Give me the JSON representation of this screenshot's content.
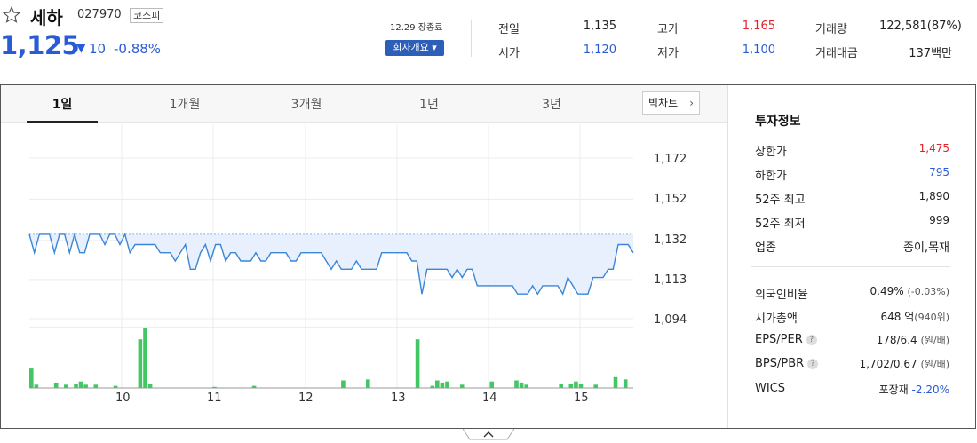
{
  "stock": {
    "name": "세하",
    "code": "027970",
    "market": "코스피",
    "price": "1,125",
    "change_arrow": "▼",
    "change": "10",
    "change_rate": "-0.88%"
  },
  "session": {
    "close_label": "12.29 장종료",
    "overview_button": "회사개요 ▾"
  },
  "quote": {
    "prev_close": {
      "label": "전일",
      "value": "1,135"
    },
    "open": {
      "label": "시가",
      "value": "1,120"
    },
    "high": {
      "label": "고가",
      "value": "1,165"
    },
    "low": {
      "label": "저가",
      "value": "1,100"
    },
    "volume": {
      "label": "거래량",
      "value": "122,581(87%)"
    },
    "amount": {
      "label": "거래대금",
      "value": "137백만"
    }
  },
  "tabs": [
    "1일",
    "1개월",
    "3개월",
    "1년",
    "3년"
  ],
  "active_tab": "1일",
  "big_chart_button": "빅차트",
  "colors": {
    "up": "#e0232b",
    "down": "#2a5bd7",
    "line": "#3b86d8",
    "fill": "#e7f0fc",
    "volume": "#43c764"
  },
  "chart_data": {
    "type": "line",
    "y_ticks": [
      "1,172",
      "1,152",
      "1,132",
      "1,113",
      "1,094"
    ],
    "ylim": [
      1094,
      1172
    ],
    "x_ticks": [
      "10",
      "11",
      "12",
      "13",
      "14",
      "15"
    ],
    "prev_close": 1135,
    "price_series": [
      1135,
      1126,
      1135,
      1135,
      1135,
      1126,
      1135,
      1135,
      1126,
      1135,
      1126,
      1126,
      1135,
      1135,
      1135,
      1130,
      1135,
      1135,
      1130,
      1135,
      1126,
      1130,
      1130,
      1130,
      1130,
      1130,
      1126,
      1126,
      1126,
      1122,
      1126,
      1130,
      1118,
      1118,
      1126,
      1130,
      1122,
      1130,
      1130,
      1122,
      1126,
      1126,
      1122,
      1122,
      1122,
      1126,
      1122,
      1122,
      1126,
      1126,
      1126,
      1126,
      1122,
      1122,
      1126,
      1126,
      1126,
      1126,
      1126,
      1122,
      1118,
      1122,
      1118,
      1118,
      1118,
      1122,
      1118,
      1118,
      1118,
      1118,
      1126,
      1126,
      1126,
      1126,
      1126,
      1126,
      1122,
      1122,
      1106,
      1118,
      1118,
      1118,
      1118,
      1118,
      1114,
      1118,
      1114,
      1118,
      1118,
      1110,
      1110,
      1110,
      1110,
      1110,
      1110,
      1110,
      1110,
      1106,
      1106,
      1106,
      1110,
      1106,
      1110,
      1110,
      1110,
      1110,
      1106,
      1114,
      1110,
      1106,
      1106,
      1106,
      1114,
      1114,
      1114,
      1118,
      1118,
      1130,
      1130,
      1130,
      1126
    ],
    "volume_series": [
      18,
      3,
      0,
      0,
      0,
      5,
      0,
      3,
      0,
      4,
      6,
      3,
      0,
      3,
      0,
      0,
      0,
      2,
      0,
      0,
      0,
      0,
      45,
      55,
      4,
      0,
      0,
      0,
      0,
      0,
      0,
      0,
      0,
      0,
      0,
      0,
      0,
      1,
      0,
      0,
      0,
      0,
      0,
      0,
      0,
      2,
      0,
      0,
      0,
      0,
      0,
      0,
      0,
      0,
      0,
      0,
      0,
      0,
      0,
      0,
      0,
      0,
      0,
      7,
      0,
      0,
      0,
      0,
      8,
      0,
      0,
      0,
      0,
      0,
      0,
      0,
      0,
      0,
      45,
      0,
      0,
      2,
      7,
      5,
      6,
      0,
      0,
      3,
      0,
      0,
      0,
      0,
      0,
      6,
      0,
      0,
      0,
      0,
      7,
      5,
      3,
      0,
      0,
      0,
      0,
      0,
      0,
      4,
      0,
      4,
      6,
      4,
      0,
      0,
      3,
      0,
      0,
      0,
      10,
      0,
      8,
      0
    ]
  },
  "invest_info": {
    "title": "투자정보",
    "upper_limit": {
      "label": "상한가",
      "value": "1,475"
    },
    "lower_limit": {
      "label": "하한가",
      "value": "795"
    },
    "high_52w": {
      "label": "52주 최고",
      "value": "1,890"
    },
    "low_52w": {
      "label": "52주 최저",
      "value": "999"
    },
    "industry": {
      "label": "업종",
      "value": "종이,목재"
    },
    "foreign_ratio": {
      "label": "외국인비율",
      "value": "0.49%",
      "extra": "(-0.03%)"
    },
    "market_cap": {
      "label": "시가총액",
      "value": "648 억",
      "extra": "(940위)"
    },
    "eps_per": {
      "label": "EPS/PER",
      "help": "?",
      "value": "178/6.4",
      "extra": "(원/배)"
    },
    "bps_pbr": {
      "label": "BPS/PBR",
      "help": "?",
      "value": "1,702/0.67",
      "extra": "(원/배)"
    },
    "wics": {
      "label": "WICS",
      "value": "포장재",
      "extra": "-2.20%"
    }
  },
  "fold_icon": "chevron-up-icon"
}
